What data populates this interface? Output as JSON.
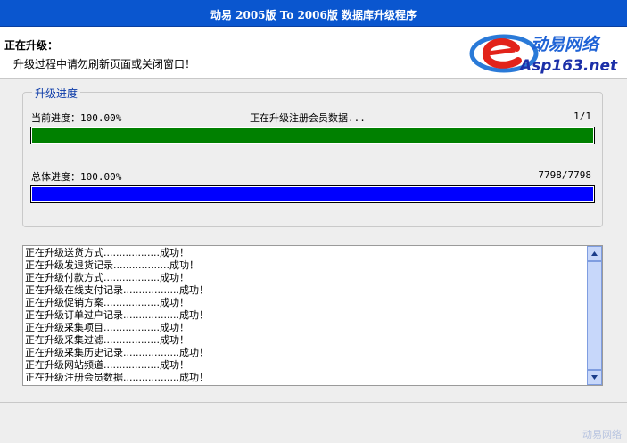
{
  "window": {
    "title": "动易 2005版 To 2006版 数据库升级程序"
  },
  "header": {
    "status_title": "正在升级：",
    "status_note": "升级过程中请勿刷新页面或关闭窗口！",
    "logo": {
      "brand_cn": "动易网络",
      "brand_en": "Asp163.net"
    }
  },
  "progress": {
    "legend": "升级进度",
    "current": {
      "label": "当前进度：100.00%",
      "status": "正在升级注册会员数据...",
      "count": "1/1",
      "fraction": 1.0,
      "color": "#008000"
    },
    "total": {
      "label": "总体进度：100.00%",
      "count": "7798/7798",
      "fraction": 1.0,
      "color": "#0000ff"
    }
  },
  "log": {
    "lines": [
      "正在升级送货方式..................成功！",
      "正在升级发退货记录..................成功！",
      "正在升级付款方式..................成功！",
      "正在升级在线支付记录..................成功！",
      "正在升级促销方案..................成功！",
      "正在升级订单过户记录..................成功！",
      "正在升级采集项目..................成功！",
      "正在升级采集过滤..................成功！",
      "正在升级采集历史记录..................成功！",
      "正在升级网站频道..................成功！",
      "正在升级注册会员数据..................成功！"
    ]
  },
  "footer": {
    "watermark": "动易网络"
  }
}
